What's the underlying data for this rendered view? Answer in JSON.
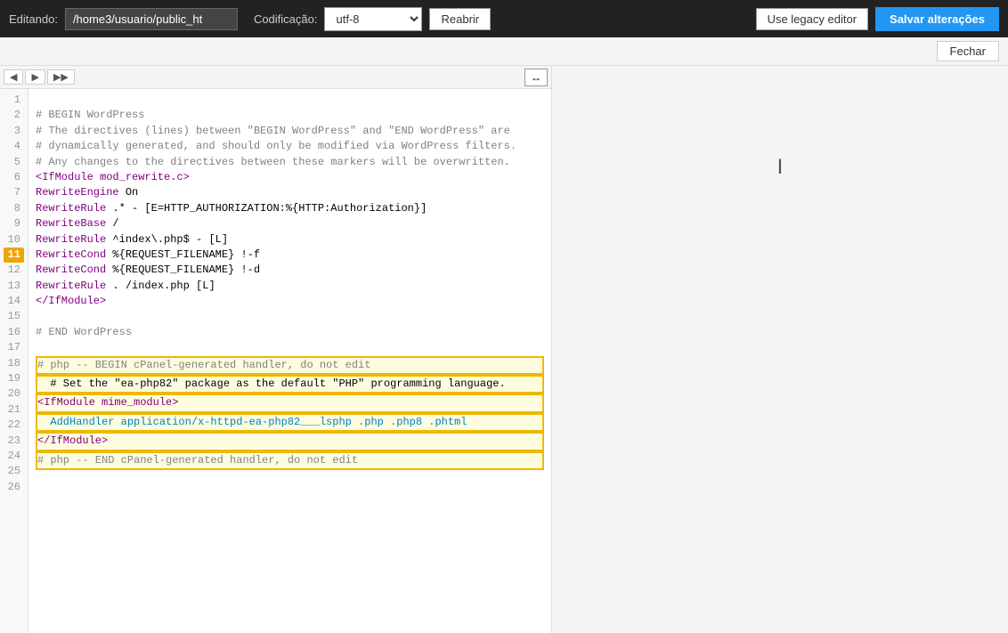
{
  "toolbar": {
    "editing_label": "Editando:",
    "filepath": "/home3/usuario/public_ht",
    "encoding_label": "Codificação:",
    "encoding_value": "utf-8",
    "reopen_label": "Reabrir",
    "legacy_btn_label": "Use legacy editor",
    "save_btn_label": "Salvar alterações",
    "close_btn_label": "Fechar"
  },
  "editor": {
    "expand_icon": "↔",
    "lines": [
      {
        "n": 1,
        "text": ""
      },
      {
        "n": 2,
        "text": "# BEGIN WordPress"
      },
      {
        "n": 3,
        "text": "# The directives (lines) between \"BEGIN WordPress\" and \"END WordPress\" are"
      },
      {
        "n": 4,
        "text": "# dynamically generated, and should only be modified via WordPress filters."
      },
      {
        "n": 5,
        "text": "# Any changes to the directives between these markers will be overwritten."
      },
      {
        "n": 6,
        "text": "<IfModule mod_rewrite.c>"
      },
      {
        "n": 7,
        "text": "RewriteEngine On"
      },
      {
        "n": 8,
        "text": "RewriteRule .* - [E=HTTP_AUTHORIZATION:%{HTTP:Authorization}]"
      },
      {
        "n": 9,
        "text": "RewriteBase /"
      },
      {
        "n": 10,
        "text": "RewriteRule ^index\\.php$ - [L]"
      },
      {
        "n": 11,
        "text": "RewriteCond %{REQUEST_FILENAME} !-f"
      },
      {
        "n": 12,
        "text": "RewriteCond %{REQUEST_FILENAME} !-d"
      },
      {
        "n": 13,
        "text": "RewriteRule . /index.php [L]"
      },
      {
        "n": 14,
        "text": "</IfModule>"
      },
      {
        "n": 15,
        "text": ""
      },
      {
        "n": 16,
        "text": "# END WordPress"
      },
      {
        "n": 17,
        "text": ""
      },
      {
        "n": 18,
        "text": "# php -- BEGIN cPanel-generated handler, do not edit",
        "highlight": true
      },
      {
        "n": 19,
        "text": "  # Set the \"ea-php82\" package as the default \"PHP\" programming language.",
        "highlight": true
      },
      {
        "n": 20,
        "text": "<IfModule mime_module>",
        "highlight": true
      },
      {
        "n": 21,
        "text": "  AddHandler application/x-httpd-ea-php82___lsphp .php .php8 .phtml",
        "highlight": true
      },
      {
        "n": 22,
        "text": "</IfModule>",
        "highlight": true
      },
      {
        "n": 23,
        "text": "# php -- END cPanel-generated handler, do not edit",
        "highlight": true
      },
      {
        "n": 24,
        "text": ""
      },
      {
        "n": 25,
        "text": ""
      },
      {
        "n": 26,
        "text": ""
      }
    ],
    "highlight_line": 11
  }
}
